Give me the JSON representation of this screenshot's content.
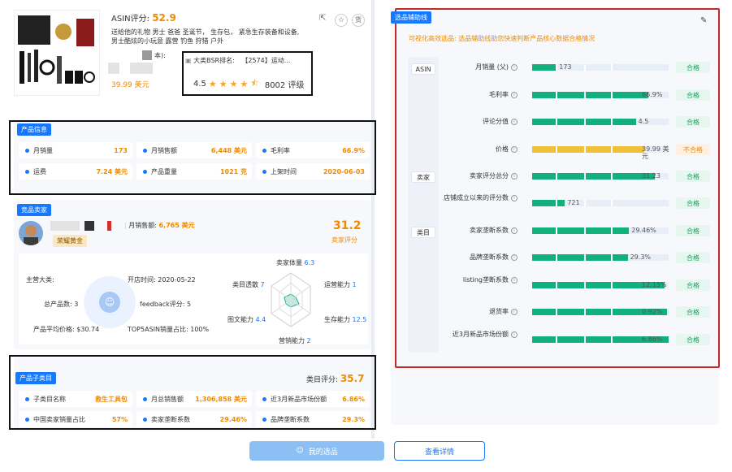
{
  "product": {
    "asin_label": "ASIN评分:",
    "asin_score": "52.9",
    "title_line1": "送给他的礼物 男士 爸爸 圣诞节， 生存包， 紧急生存装备和设备,",
    "title_line2": "男士酷炫的小玩意 露营 钓鱼 狩猎 户外",
    "partial_text": "本):",
    "price": "39.99 美元",
    "bsr_label": "大类BSR排名:",
    "bsr_value": "【2574】运动...",
    "rating": "4.5",
    "reviews": "8002 评级"
  },
  "product_info": {
    "tag": "产品信息",
    "items": [
      {
        "label": "月销量",
        "value": "173"
      },
      {
        "label": "月销售额",
        "value": "6,448 美元"
      },
      {
        "label": "毛利率",
        "value": "66.9%"
      },
      {
        "label": "运费",
        "value": "7.24 美元"
      },
      {
        "label": "产品重量",
        "value": "1021 克"
      },
      {
        "label": "上架时间",
        "value": "2020-06-03"
      }
    ]
  },
  "seller": {
    "tag": "竞品卖家",
    "badge": "荣耀黄金",
    "monthly_sales_label": "月销售额:",
    "monthly_sales_value": "6,765 美元",
    "score": "31.2",
    "score_label": "卖家评分",
    "main_category": "主营大类:",
    "open_time": "开店时间: 2020-05-22",
    "total_products": "总产品数: 3",
    "feedback": "feedback评分: 5",
    "avg_price": "产品平均价格: $30.74",
    "top_share": "TOP5ASIN销量占比: 100%",
    "radar": {
      "top": {
        "label": "卖家体量",
        "value": "6.3"
      },
      "upper_right": {
        "label": "运营能力",
        "value": "1"
      },
      "lower_right": {
        "label": "生存能力",
        "value": "12.5"
      },
      "bottom": {
        "label": "营销能力",
        "value": "2"
      },
      "lower_left": {
        "label": "图文能力",
        "value": "4.4"
      },
      "upper_left": {
        "label": "类目透散",
        "value": "7"
      }
    }
  },
  "subcategory": {
    "tag": "产品子类目",
    "score_label": "类目评分:",
    "score": "35.7",
    "items": [
      {
        "label": "子类目名称",
        "value": "救生工具包"
      },
      {
        "label": "月总销售额",
        "value": "1,306,858 美元"
      },
      {
        "label": "近3月新品市场份额",
        "value": "6.86%"
      },
      {
        "label": "中国卖家销量占比",
        "value": "57%"
      },
      {
        "label": "卖家垄断系数",
        "value": "29.46%"
      },
      {
        "label": "品牌垄断系数",
        "value": "29.3%"
      }
    ]
  },
  "buttons": {
    "my_selection": "我的选品",
    "view_detail": "查看详情"
  },
  "helper": {
    "tag": "选品辅助线",
    "subtitle": "可视化高效选品: 选品辅助线助您快速判断产品核心数据合格情况",
    "groups": [
      "ASIN",
      "卖家",
      "类目"
    ],
    "rows": [
      {
        "label": "月销量 (父)",
        "value": "173",
        "fill": 0.18,
        "color": "#12b07a",
        "status": "合格"
      },
      {
        "label": "毛利率",
        "value": "66.9%",
        "fill": 0.85,
        "color": "#12b07a",
        "status": "合格"
      },
      {
        "label": "评论分值",
        "value": "4.5",
        "fill": 0.76,
        "color": "#12b07a",
        "status": "合格"
      },
      {
        "label": "价格",
        "value": "39.99 美元",
        "fill": 0.82,
        "color": "#f0c038",
        "status": "不合格"
      },
      {
        "label": "卖家评分总分",
        "value": "31.23",
        "fill": 0.9,
        "color": "#12b07a",
        "status": "合格"
      },
      {
        "label": "店铺成立以来的评分数",
        "value": "721",
        "fill": 0.24,
        "color": "#12b07a",
        "status": "合格"
      },
      {
        "label": "卖家垄断系数",
        "value": "29.46%",
        "fill": 0.71,
        "color": "#12b07a",
        "status": "合格"
      },
      {
        "label": "品牌垄断系数",
        "value": "29.3%",
        "fill": 0.7,
        "color": "#12b07a",
        "status": "合格"
      },
      {
        "label": "listing垄断系数",
        "value": "12.15%",
        "fill": 0.97,
        "color": "#12b07a",
        "status": "合格"
      },
      {
        "label": "退货率",
        "value": "0.92%",
        "fill": 0.99,
        "color": "#12b07a",
        "status": "合格"
      },
      {
        "label": "近3月新品市场份额",
        "value": "6.86%",
        "fill": 1.0,
        "color": "#12b07a",
        "status": "合格"
      }
    ]
  },
  "colors": {
    "accent": "#1677ff",
    "orange": "#f08a00",
    "green": "#12b07a",
    "red_frame": "#c62828"
  },
  "icons": [
    "share-icon",
    "star-icon",
    "cargo-icon",
    "edit-icon",
    "info-icon",
    "smile-icon",
    "user-icon"
  ]
}
